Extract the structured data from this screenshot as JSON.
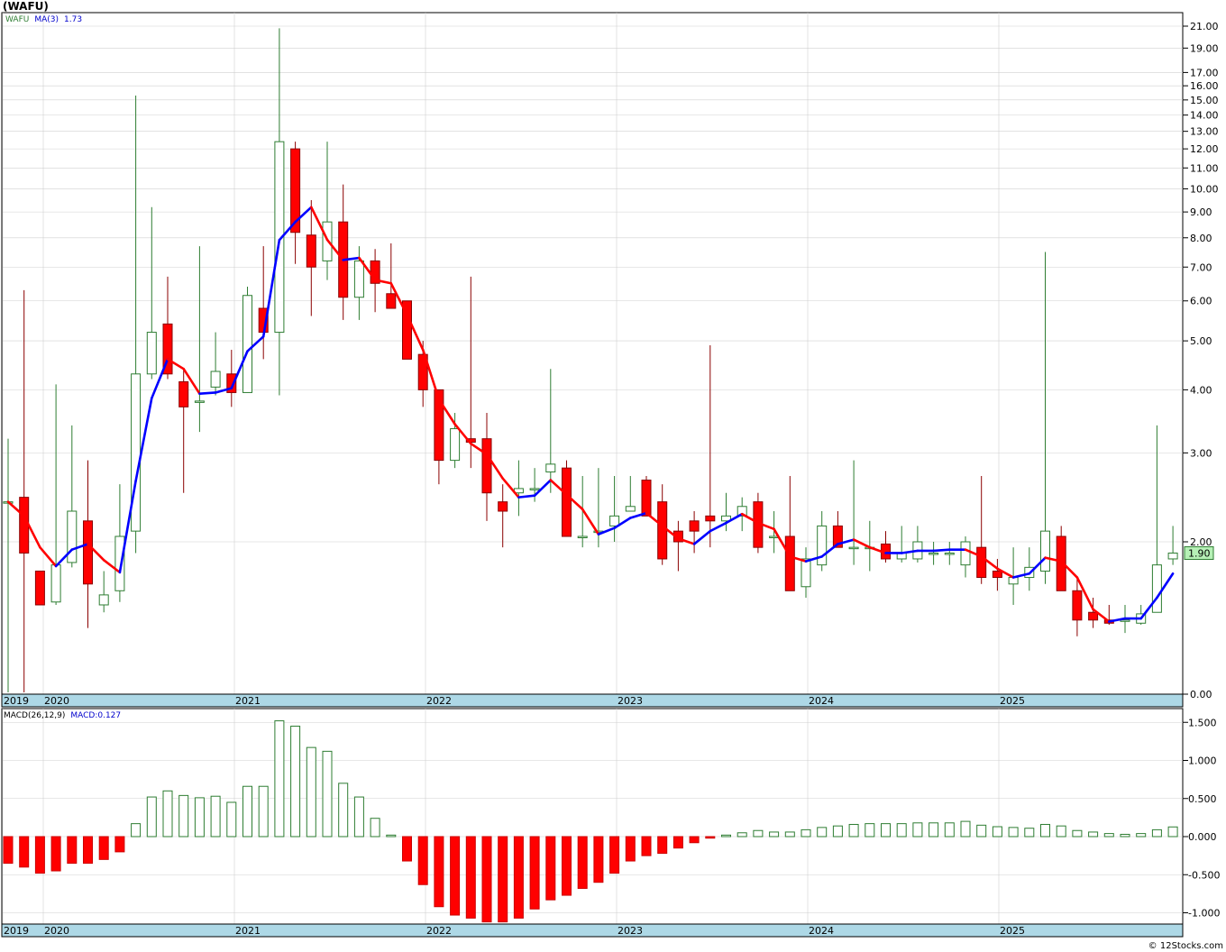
{
  "title": "(WAFU)",
  "credit": "© 12Stocks.com",
  "colors": {
    "up": "#2e7d32",
    "down": "#ff0000",
    "ma_up": "#0000ff",
    "ma_down": "#ff0000",
    "axis_band": "#add8e6",
    "grid": "#d0d0d0",
    "price_label_bg": "#b6f0b6"
  },
  "chart_data": [
    {
      "type": "candlestick",
      "legend": {
        "symbol": "WAFU",
        "ma": "MA(3)",
        "ma_value": "1.73"
      },
      "price_label": "1.90",
      "y_scale": "log",
      "y_ticks": [
        "21.00",
        "19.00",
        "17.00",
        "16.00",
        "15.00",
        "14.00",
        "13.00",
        "12.00",
        "11.00",
        "10.00",
        "9.00",
        "8.00",
        "7.00",
        "6.00",
        "5.00",
        "4.00",
        "3.00",
        "2.00",
        "0.00"
      ],
      "x_ticks": [
        "2019",
        "2020",
        "2021",
        "2022",
        "2023",
        "2024",
        "2025"
      ],
      "candles": [
        [
          2.4,
          2.4,
          3.2,
          0.05
        ],
        [
          2.45,
          1.9,
          6.3,
          0.05
        ],
        [
          1.75,
          1.5,
          1.75,
          1.5
        ],
        [
          1.52,
          1.8,
          4.1,
          1.5
        ],
        [
          1.82,
          2.3,
          3.4,
          1.78
        ],
        [
          2.2,
          1.65,
          2.9,
          1.35
        ],
        [
          1.5,
          1.57,
          1.75,
          1.45
        ],
        [
          1.6,
          2.05,
          2.6,
          1.52
        ],
        [
          2.1,
          4.3,
          15.3,
          1.9
        ],
        [
          4.3,
          5.2,
          9.2,
          4.2
        ],
        [
          5.4,
          4.3,
          6.7,
          4.2
        ],
        [
          4.15,
          3.7,
          4.4,
          2.5
        ],
        [
          3.8,
          3.8,
          7.7,
          3.3
        ],
        [
          4.05,
          4.35,
          5.2,
          3.9
        ],
        [
          4.3,
          3.95,
          4.8,
          3.7
        ],
        [
          3.95,
          6.15,
          6.4,
          4.5
        ],
        [
          5.8,
          5.2,
          7.7,
          4.6
        ],
        [
          5.2,
          12.4,
          20.8,
          3.9
        ],
        [
          12.0,
          8.2,
          12.4,
          7.1
        ],
        [
          8.1,
          7.0,
          9.5,
          5.6
        ],
        [
          7.2,
          8.6,
          12.4,
          6.6
        ],
        [
          8.6,
          6.1,
          10.2,
          5.5
        ],
        [
          6.1,
          7.2,
          7.7,
          5.5
        ],
        [
          7.2,
          6.5,
          7.6,
          5.7
        ],
        [
          6.2,
          5.8,
          7.8,
          5.8
        ],
        [
          6.0,
          4.6,
          6.0,
          4.6
        ],
        [
          4.7,
          4.0,
          5.0,
          3.7
        ],
        [
          4.0,
          2.9,
          4.0,
          2.6
        ],
        [
          2.9,
          3.35,
          3.6,
          2.8
        ],
        [
          3.2,
          3.15,
          6.7,
          2.8
        ],
        [
          3.2,
          2.5,
          3.6,
          2.2
        ],
        [
          2.4,
          2.3,
          2.6,
          1.95
        ],
        [
          2.5,
          2.55,
          2.9,
          2.25
        ],
        [
          2.55,
          2.55,
          2.8,
          2.4
        ],
        [
          2.75,
          2.85,
          4.4,
          2.5
        ],
        [
          2.8,
          2.05,
          2.9,
          2.05
        ],
        [
          2.05,
          2.05,
          2.7,
          1.95
        ],
        [
          2.1,
          2.1,
          2.8,
          1.95
        ],
        [
          2.15,
          2.25,
          2.7,
          2.0
        ],
        [
          2.3,
          2.35,
          2.7,
          2.3
        ],
        [
          2.65,
          2.25,
          2.7,
          2.25
        ],
        [
          2.4,
          1.85,
          2.6,
          1.8
        ],
        [
          2.1,
          2.0,
          2.2,
          1.75
        ],
        [
          2.2,
          2.1,
          2.3,
          1.9
        ],
        [
          2.25,
          2.2,
          4.9,
          1.95
        ],
        [
          2.2,
          2.25,
          2.5,
          2.1
        ],
        [
          2.25,
          2.35,
          2.45,
          2.1
        ],
        [
          2.4,
          1.95,
          2.5,
          1.9
        ],
        [
          2.05,
          2.05,
          2.3,
          1.9
        ],
        [
          2.05,
          1.6,
          2.7,
          1.6
        ],
        [
          1.63,
          1.85,
          1.95,
          1.55
        ],
        [
          1.8,
          2.15,
          2.3,
          1.75
        ],
        [
          2.15,
          1.95,
          2.3,
          1.95
        ],
        [
          1.95,
          1.95,
          2.9,
          1.8
        ],
        [
          1.95,
          1.95,
          2.2,
          1.75
        ],
        [
          1.98,
          1.85,
          2.1,
          1.82
        ],
        [
          1.85,
          1.9,
          2.15,
          1.82
        ],
        [
          1.85,
          2.0,
          2.15,
          1.82
        ],
        [
          1.9,
          1.9,
          2.0,
          1.8
        ],
        [
          1.9,
          1.9,
          2.0,
          1.8
        ],
        [
          1.8,
          2.0,
          2.05,
          1.7
        ],
        [
          1.95,
          1.7,
          2.7,
          1.65
        ],
        [
          1.75,
          1.7,
          1.85,
          1.6
        ],
        [
          1.65,
          1.7,
          1.95,
          1.5
        ],
        [
          1.7,
          1.78,
          1.95,
          1.6
        ],
        [
          1.75,
          2.1,
          7.5,
          1.65
        ],
        [
          2.05,
          1.6,
          2.15,
          1.6
        ],
        [
          1.6,
          1.4,
          1.7,
          1.3
        ],
        [
          1.45,
          1.4,
          1.55,
          1.35
        ],
        [
          1.4,
          1.38,
          1.5,
          1.37
        ],
        [
          1.4,
          1.4,
          1.5,
          1.32
        ],
        [
          1.38,
          1.44,
          1.5,
          1.37
        ],
        [
          1.45,
          1.8,
          3.4,
          1.45
        ],
        [
          1.85,
          1.9,
          2.15,
          1.8
        ]
      ],
      "ma": [
        2.4,
        2.25,
        1.95,
        1.79,
        1.93,
        1.98,
        1.84,
        1.74,
        2.64,
        3.85,
        4.6,
        4.4,
        3.93,
        3.95,
        4.03,
        4.77,
        5.1,
        7.92,
        8.6,
        9.2,
        7.93,
        7.23,
        7.3,
        6.6,
        6.5,
        5.63,
        4.8,
        3.83,
        3.42,
        3.13,
        2.98,
        2.67,
        2.45,
        2.47,
        2.65,
        2.48,
        2.32,
        2.07,
        2.13,
        2.23,
        2.28,
        2.15,
        2.03,
        1.98,
        2.1,
        2.18,
        2.27,
        2.18,
        2.12,
        1.87,
        1.83,
        1.87,
        1.98,
        2.02,
        1.95,
        1.9,
        1.9,
        1.92,
        1.92,
        1.93,
        1.93,
        1.87,
        1.77,
        1.7,
        1.73,
        1.86,
        1.83,
        1.7,
        1.47,
        1.39,
        1.41,
        1.41,
        1.55,
        1.73
      ]
    },
    {
      "type": "bar",
      "legend": {
        "name": "MACD(26,12,9)",
        "value_label": "MACD:0.127"
      },
      "y_ticks": [
        "1.500",
        "1.000",
        "0.500",
        "0.000",
        "-0.500",
        "-1.000"
      ],
      "x_ticks": [
        "2019",
        "2020",
        "2021",
        "2022",
        "2023",
        "2024",
        "2025"
      ],
      "values": [
        -0.35,
        -0.4,
        -0.48,
        -0.45,
        -0.35,
        -0.35,
        -0.3,
        -0.2,
        0.17,
        0.52,
        0.6,
        0.54,
        0.51,
        0.53,
        0.45,
        0.66,
        0.66,
        1.52,
        1.45,
        1.17,
        1.12,
        0.7,
        0.52,
        0.24,
        0.02,
        -0.32,
        -0.63,
        -0.92,
        -1.03,
        -1.07,
        -1.12,
        -1.12,
        -1.07,
        -0.95,
        -0.83,
        -0.77,
        -0.68,
        -0.6,
        -0.48,
        -0.32,
        -0.25,
        -0.22,
        -0.15,
        -0.08,
        -0.02,
        0.02,
        0.05,
        0.08,
        0.06,
        0.06,
        0.09,
        0.12,
        0.14,
        0.16,
        0.17,
        0.17,
        0.17,
        0.18,
        0.18,
        0.18,
        0.2,
        0.15,
        0.13,
        0.12,
        0.11,
        0.16,
        0.14,
        0.08,
        0.06,
        0.04,
        0.03,
        0.04,
        0.09,
        0.127
      ]
    }
  ]
}
